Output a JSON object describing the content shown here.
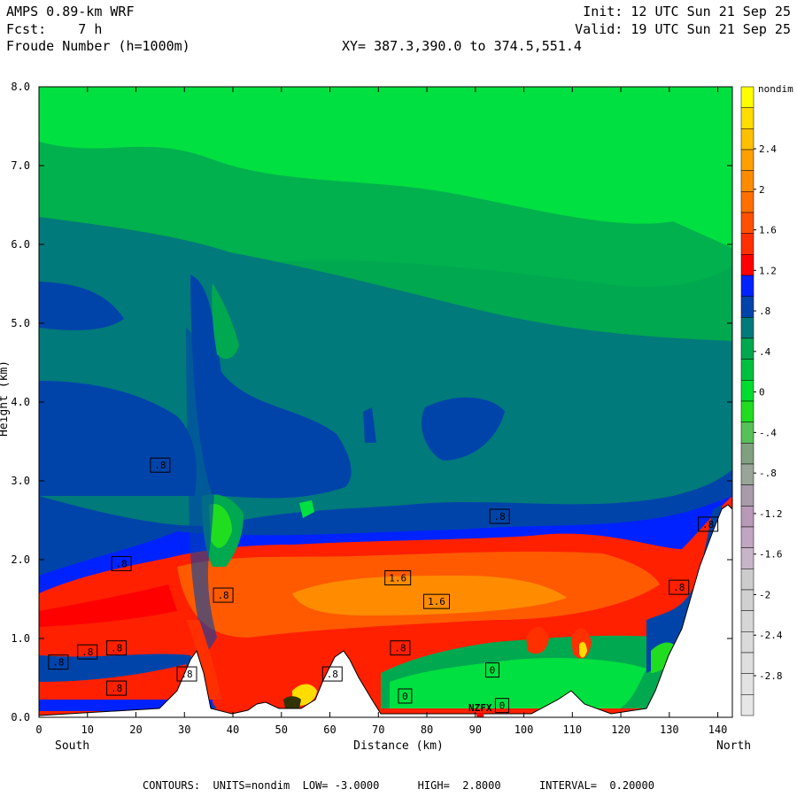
{
  "header": {
    "model": "AMPS 0.89-km WRF",
    "fcst": "Fcst:    7 h",
    "field": "Froude Number (h=1000m)",
    "init": "Init: 12 UTC Sun 21 Sep 25",
    "valid": "Valid: 19 UTC Sun 21 Sep 25",
    "xy": "XY= 387.3,390.0 to 374.5,551.4"
  },
  "footer": {
    "contours": "CONTOURS:  UNITS=nondim  LOW= -3.0000      HIGH=  2.8000      INTERVAL=  0.20000"
  },
  "chart_data": {
    "type": "contour-cross-section",
    "xlabel": "Distance (km)",
    "xlabel_left": "South",
    "xlabel_right": "North",
    "ylabel": "Height (km)",
    "xlim": [
      0,
      143
    ],
    "ylim": [
      0,
      8
    ],
    "x_ticks": [
      "0",
      "10",
      "20",
      "30",
      "40",
      "50",
      "60",
      "70",
      "80",
      "90",
      "100",
      "110",
      "120",
      "130",
      "140"
    ],
    "y_ticks": [
      "0.0",
      "1.0",
      "2.0",
      "3.0",
      "4.0",
      "5.0",
      "6.0",
      "7.0",
      "8.0"
    ],
    "colorbar_unit": "nondim",
    "colorbar_labels": [
      "2.4",
      "2",
      "1.6",
      "1.2",
      ".8",
      ".4",
      "0",
      "-.4",
      "-.8",
      "-1.2",
      "-1.6",
      "-2",
      "-2.4",
      "-2.8"
    ],
    "colorbar_colors": [
      "#ffff00",
      "#ffdd00",
      "#ffc000",
      "#ffa000",
      "#ff8c00",
      "#ff7000",
      "#ff5000",
      "#ff3000",
      "#ff0000",
      "#0022ff",
      "#0044aa",
      "#007a7a",
      "#00a850",
      "#00c040",
      "#00dd30",
      "#20dd20",
      "#56c156",
      "#80a080",
      "#9aa59a",
      "#a99ba9",
      "#b899b8",
      "#c0a6c0",
      "#c8b4c8",
      "#cccccc",
      "#d0d0d0",
      "#d6d6d6",
      "#dadada",
      "#dedede",
      "#e2e2e2",
      "#e6e6e6"
    ],
    "station_label": "NZFX",
    "station_km": 91,
    "contour_labels": [
      {
        "text": ".8",
        "x": 25,
        "y": 3.2
      },
      {
        "text": ".8",
        "x": 17,
        "y": 1.95
      },
      {
        "text": ".8",
        "x": 4,
        "y": 0.7
      },
      {
        "text": ".8",
        "x": 10,
        "y": 0.83
      },
      {
        "text": ".8",
        "x": 16,
        "y": 0.88
      },
      {
        "text": ".8",
        "x": 16,
        "y": 0.37
      },
      {
        "text": ".8",
        "x": 30.5,
        "y": 0.55
      },
      {
        "text": ".8",
        "x": 38,
        "y": 1.55
      },
      {
        "text": ".8",
        "x": 60.5,
        "y": 0.55
      },
      {
        "text": ".8",
        "x": 74.5,
        "y": 0.88
      },
      {
        "text": ".8",
        "x": 95,
        "y": 2.55
      },
      {
        "text": ".8",
        "x": 132,
        "y": 1.65
      },
      {
        "text": ".8",
        "x": 138,
        "y": 2.45
      },
      {
        "text": "1.6",
        "x": 74,
        "y": 1.77
      },
      {
        "text": "1.6",
        "x": 82,
        "y": 1.47
      },
      {
        "text": "0",
        "x": 93.5,
        "y": 0.6
      },
      {
        "text": "0",
        "x": 75.5,
        "y": 0.27
      },
      {
        "text": "0",
        "x": 95.5,
        "y": 0.15
      }
    ]
  }
}
